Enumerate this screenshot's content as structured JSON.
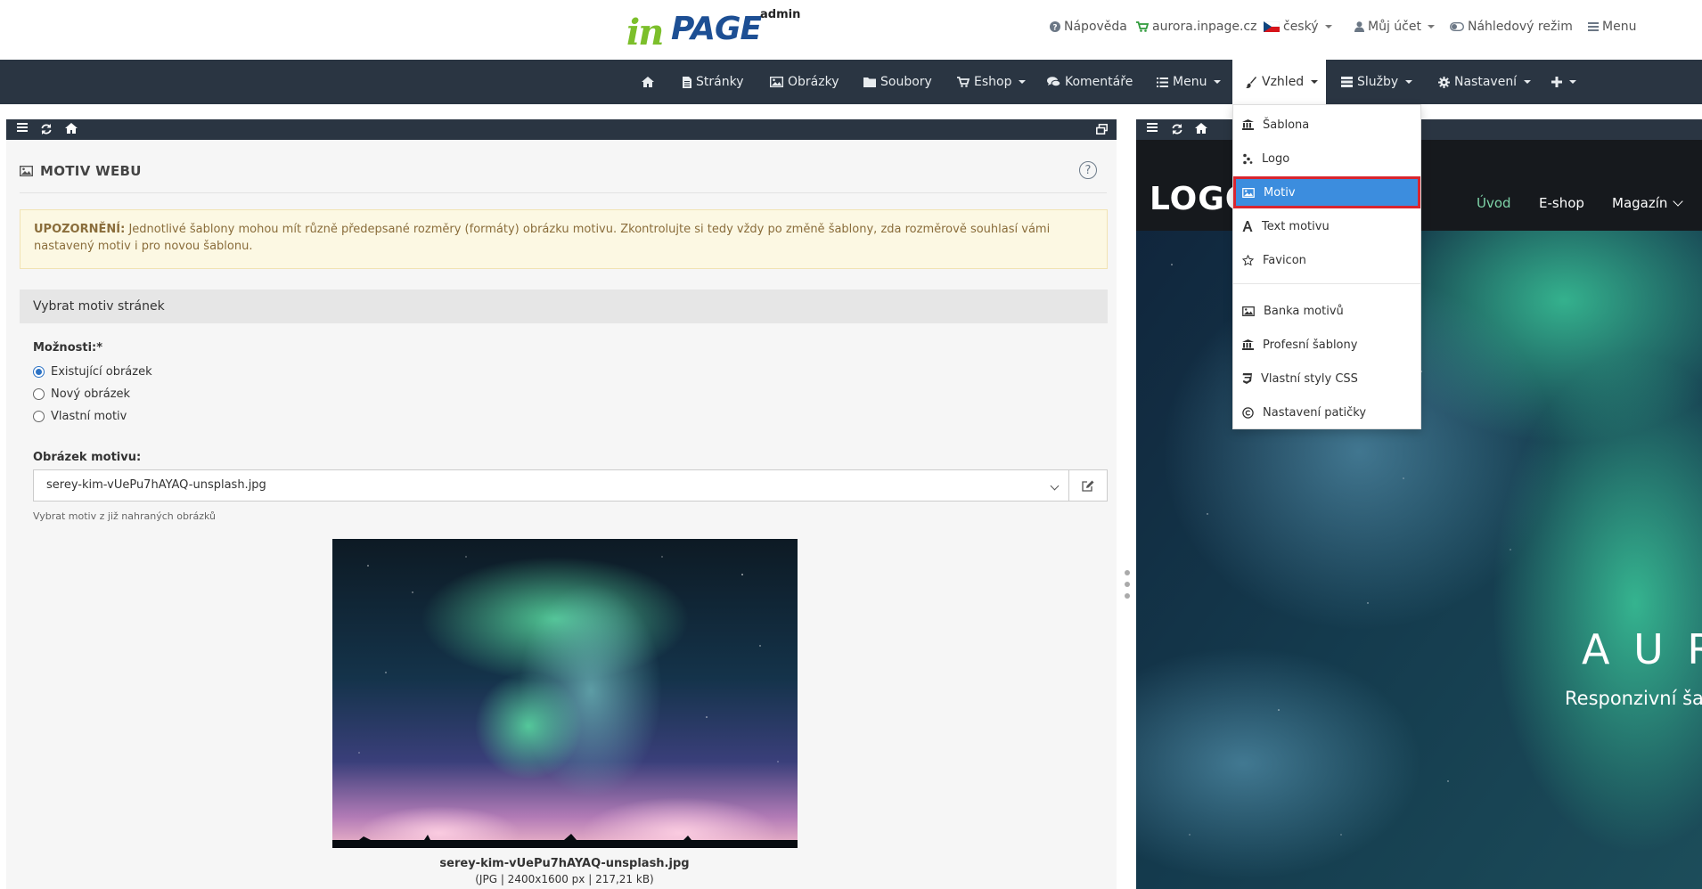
{
  "header": {
    "logo_in": "in",
    "logo_page": "PAGE",
    "logo_admin": "admin",
    "help": "Nápověda",
    "site": "aurora.inpage.cz",
    "language": "český",
    "account": "Můj účet",
    "preview_mode": "Náhledový režim",
    "menu": "Menu"
  },
  "nav": {
    "pages": "Stránky",
    "images": "Obrázky",
    "files": "Soubory",
    "eshop": "Eshop",
    "comments": "Komentáře",
    "menu": "Menu",
    "appearance": "Vzhled",
    "services": "Služby",
    "settings": "Nastavení"
  },
  "dropdown": {
    "items": [
      {
        "label": "Šablona",
        "icon": "bank-icon"
      },
      {
        "label": "Logo",
        "icon": "logo-icon"
      },
      {
        "label": "Motiv",
        "icon": "image-icon"
      },
      {
        "label": "Text motivu",
        "icon": "font-icon"
      },
      {
        "label": "Favicon",
        "icon": "star-icon"
      },
      {
        "label": "Banka motivů",
        "icon": "image-icon"
      },
      {
        "label": "Profesní šablony",
        "icon": "bank-icon"
      },
      {
        "label": "Vlastní styly CSS",
        "icon": "css3-icon"
      },
      {
        "label": "Nastavení patičky",
        "icon": "copyright-icon"
      }
    ]
  },
  "form": {
    "title": "MOTIV WEBU",
    "help": "?",
    "alert_label": "UPOZORNĚNÍ:",
    "alert_text": " Jednotlivé šablony mohou mít různě předepsané rozměry (formáty) obrázku motivu. Zkontrolujte si tedy vždy po změně šablony, zda rozměrově souhlasí vámi nastavený motiv i pro novou šablonu.",
    "section": "Vybrat motiv stránek",
    "options_label": "Možnosti:*",
    "options": [
      "Existující obrázek",
      "Nový obrázek",
      "Vlastní motiv"
    ],
    "image_label": "Obrázek motivu:",
    "selected_image": "serey-kim-vUePu7hAYAQ-unsplash.jpg",
    "hint": "Vybrat motiv z již nahraných obrázků",
    "file_name": "serey-kim-vUePu7hAYAQ-unsplash.jpg",
    "file_meta": "(JPG | 2400x1600 px | 217,21 kB)"
  },
  "preview": {
    "logo": "LOGO",
    "menu": [
      "Úvod",
      "E-shop",
      "Magazín"
    ],
    "hero_title": "A U R O",
    "hero_subtitle": "Responzivní šab"
  },
  "colors": {
    "navbar": "#2a3542",
    "accent": "#3c8dde",
    "highlight_border": "#d9252e",
    "alert_bg": "#fcf8e3",
    "preview_menu_active": "#7ed3a8"
  }
}
